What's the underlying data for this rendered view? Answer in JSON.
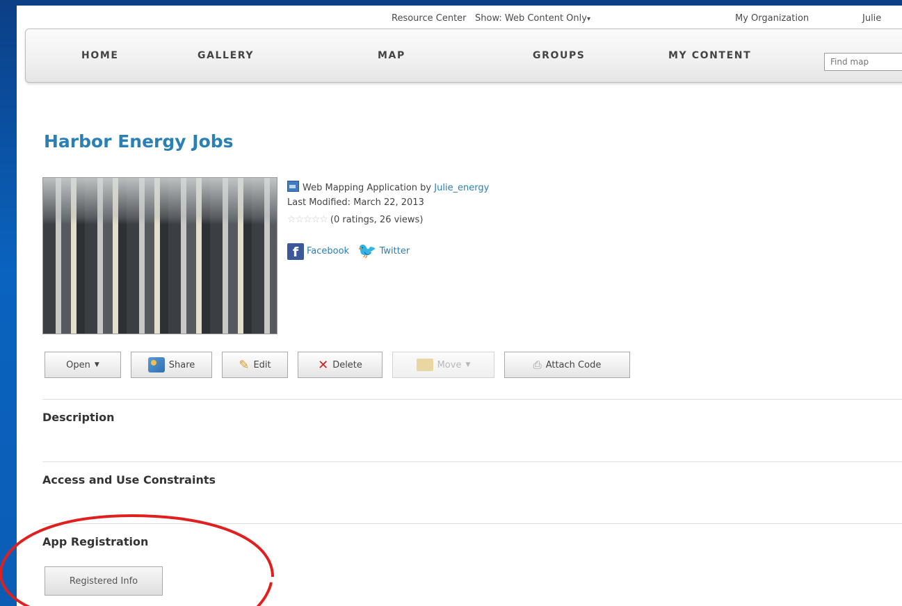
{
  "topbar": {
    "resource_center": "Resource Center",
    "show_filter": "Show: Web Content Only",
    "show_caret": "▾",
    "organization": "My Organization",
    "user": "Julie"
  },
  "nav": {
    "items": [
      "HOME",
      "GALLERY",
      "MAP",
      "GROUPS",
      "MY CONTENT"
    ],
    "search_placeholder": "Find map"
  },
  "item": {
    "title": "Harbor Energy Jobs",
    "type_prefix": "Web Mapping Application by",
    "owner": "Julie_energy",
    "last_modified": "Last Modified: March 22, 2013",
    "stars": "☆☆☆☆☆",
    "rating_text": "(0 ratings, 26 views)",
    "social": {
      "facebook": "Facebook",
      "twitter": "Twitter"
    }
  },
  "actions": {
    "open": "Open",
    "share": "Share",
    "edit": "Edit",
    "delete": "Delete",
    "move": "Move",
    "attach_code": "Attach Code"
  },
  "sections": {
    "description": "Description",
    "access": "Access and Use Constraints",
    "app_registration": "App Registration"
  },
  "registration": {
    "button_label": "Registered Info"
  },
  "icons": {
    "app": "web-app-icon",
    "facebook": "facebook-icon",
    "twitter": "twitter-bird-icon",
    "share": "share-icon",
    "edit": "pencil-icon",
    "delete": "x-icon",
    "move": "folder-icon",
    "attach": "paperclip-icon"
  },
  "colors": {
    "link": "#2a7fb4",
    "annotation": "#e0201f",
    "frame": "#0a63bf"
  }
}
